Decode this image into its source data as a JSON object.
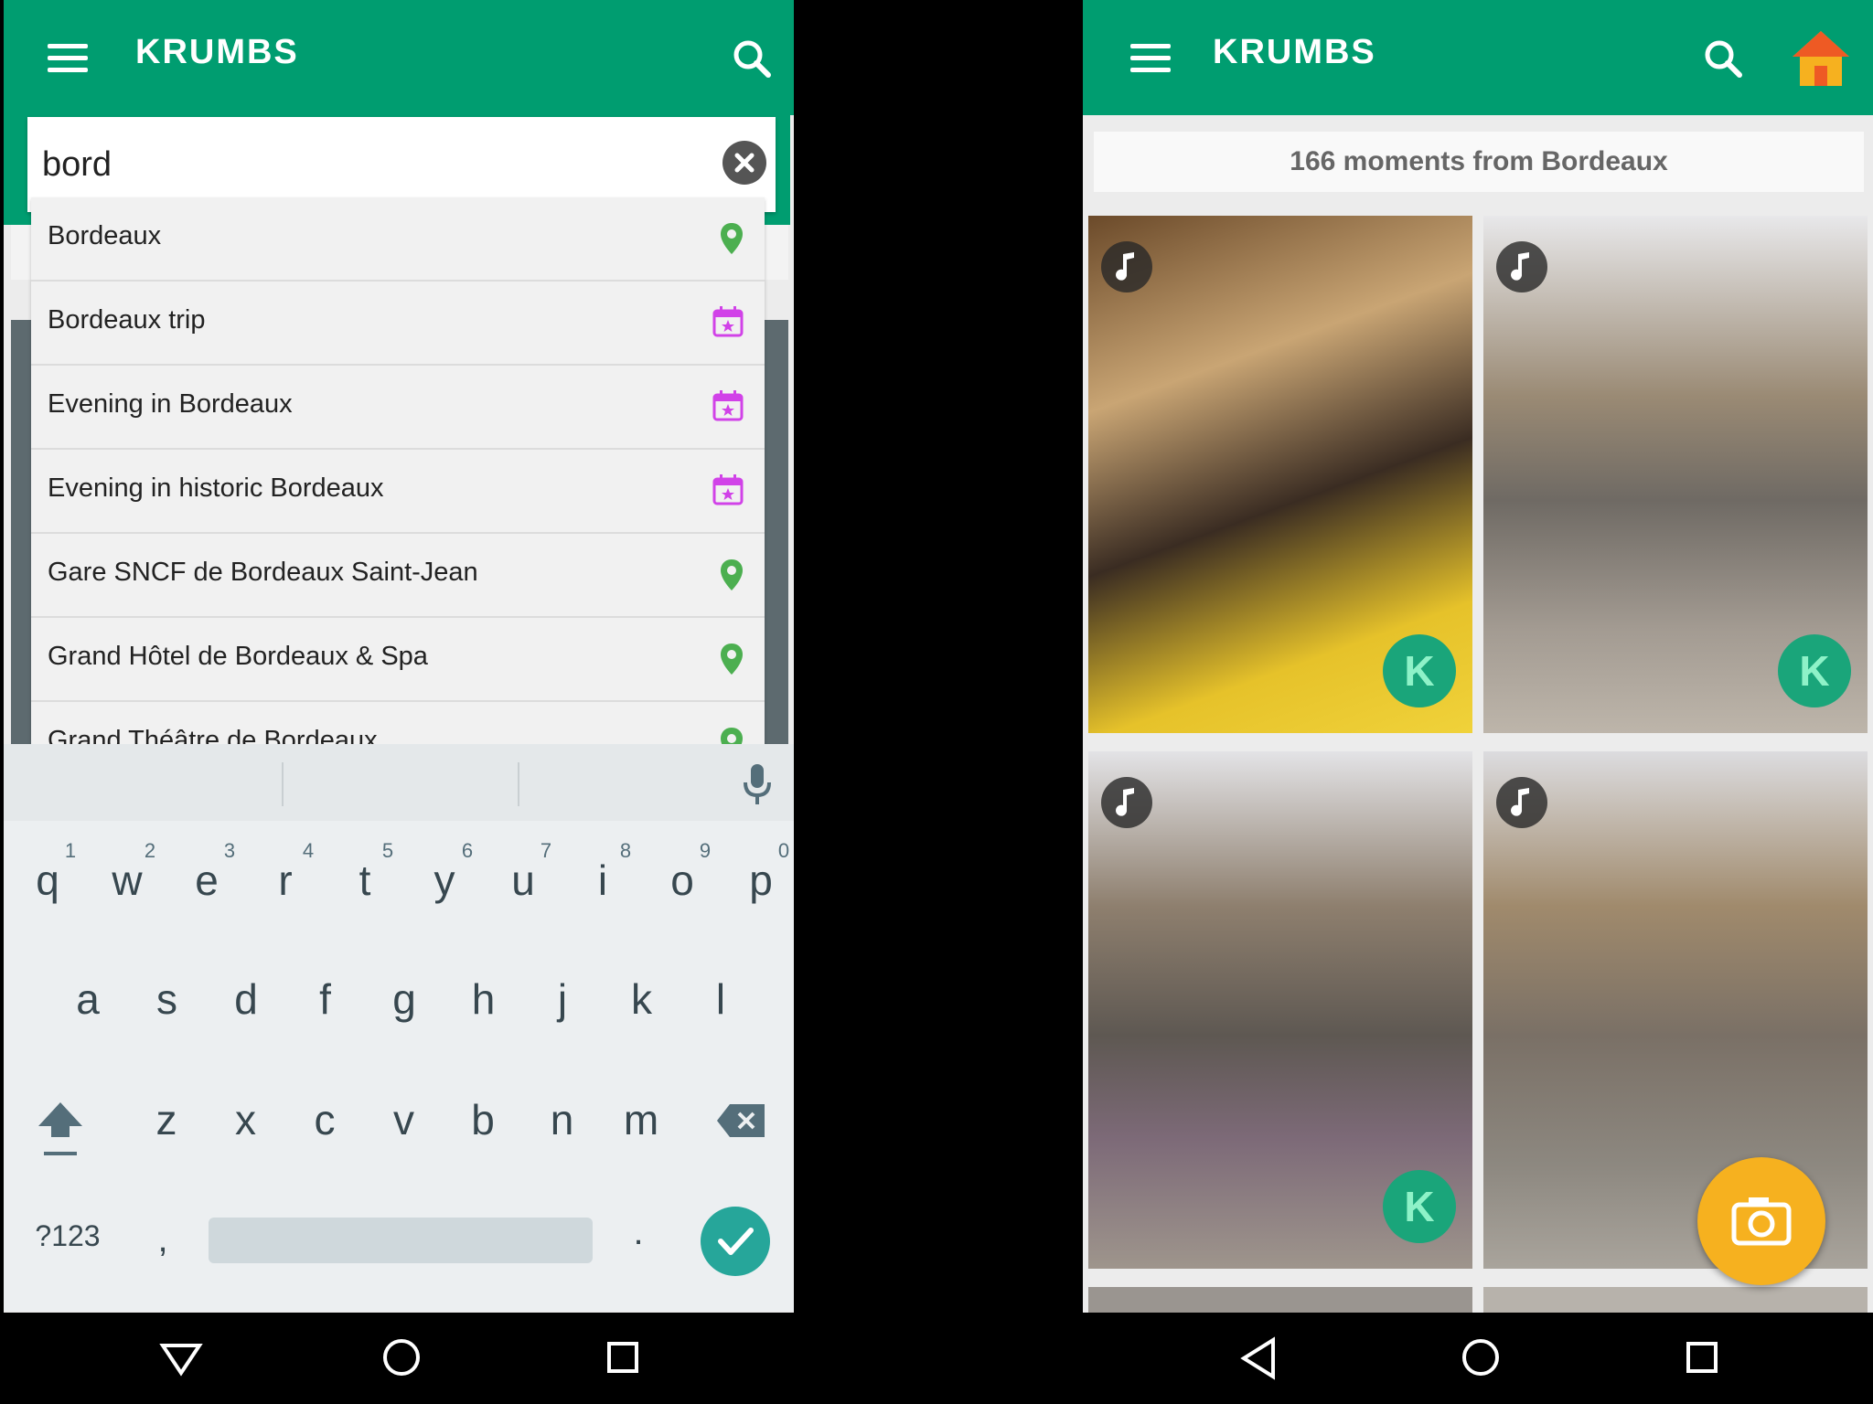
{
  "left": {
    "app_title": "KRUMBS",
    "search": {
      "value": "bord"
    },
    "suggestions": [
      {
        "label": "Bordeaux",
        "type": "place"
      },
      {
        "label": "Bordeaux trip",
        "type": "event"
      },
      {
        "label": "Evening in Bordeaux",
        "type": "event"
      },
      {
        "label": "Evening in historic Bordeaux",
        "type": "event"
      },
      {
        "label": "Gare SNCF de Bordeaux Saint-Jean",
        "type": "place"
      },
      {
        "label": "Grand Hôtel de Bordeaux & Spa",
        "type": "place"
      },
      {
        "label": "Grand Théâtre de Bordeaux",
        "type": "place"
      }
    ],
    "keyboard": {
      "row1": [
        "q",
        "w",
        "e",
        "r",
        "t",
        "y",
        "u",
        "i",
        "o",
        "p"
      ],
      "row1_hints": [
        "1",
        "2",
        "3",
        "4",
        "5",
        "6",
        "7",
        "8",
        "9",
        "0"
      ],
      "row2": [
        "a",
        "s",
        "d",
        "f",
        "g",
        "h",
        "j",
        "k",
        "l"
      ],
      "row3": [
        "z",
        "x",
        "c",
        "v",
        "b",
        "n",
        "m"
      ],
      "symbols_label": "?123",
      "comma": ",",
      "period": "."
    }
  },
  "right": {
    "app_title": "KRUMBS",
    "summary": "166 moments from Bordeaux"
  },
  "colors": {
    "brand_green": "#009d70",
    "place_pin": "#4caf50",
    "event_icon": "#d142e8",
    "fab": "#f6b11f",
    "badge_green": "#1aa57a"
  },
  "icons": {
    "menu": "hamburger-icon",
    "search": "search-icon",
    "home": "home-icon",
    "place": "location-pin-icon",
    "event": "calendar-star-icon",
    "camera": "camera-icon",
    "music": "music-note-icon"
  }
}
